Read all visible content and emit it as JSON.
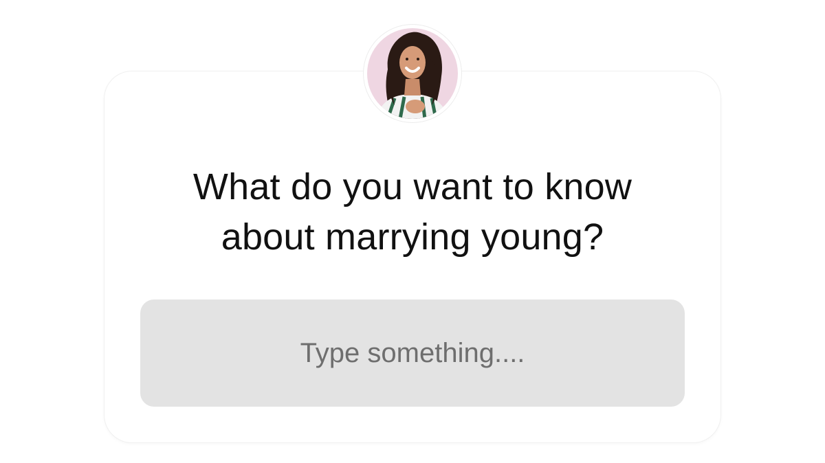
{
  "question_sticker": {
    "question_line_1": "What do you want to know",
    "question_line_2": "about marrying young?",
    "answer_placeholder": "Type something....",
    "avatar_icon": "profile-photo",
    "colors": {
      "card_background": "#ffffff",
      "input_background": "#e3e3e3",
      "question_text": "#111111",
      "placeholder_text": "#6e6e6e"
    }
  }
}
